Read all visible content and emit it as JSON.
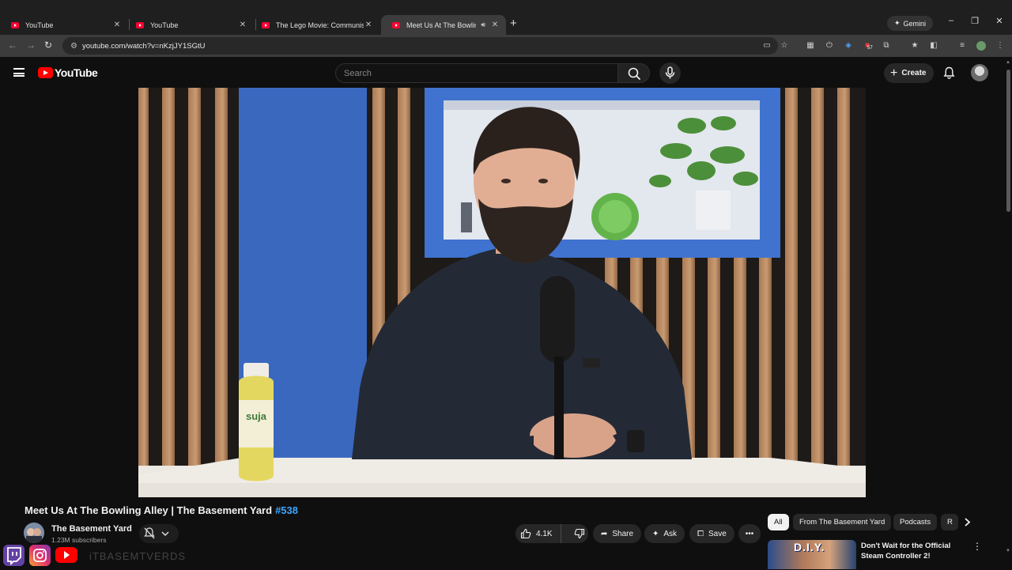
{
  "browser": {
    "tabs": [
      {
        "label": "YouTube",
        "active": false
      },
      {
        "label": "YouTube",
        "active": false
      },
      {
        "label": "The Lego Movie: Communist Pr",
        "active": false
      },
      {
        "label": "Meet Us At The Bowling All",
        "active": true
      }
    ],
    "gemini_label": "Gemini",
    "url": "youtube.com/watch?v=nKzjJY1SGtU",
    "extension_badge": "57"
  },
  "youtube": {
    "logo_text": "YouTube",
    "search_placeholder": "Search",
    "create_label": "Create"
  },
  "video": {
    "title": "Meet Us At The Bowling Alley | The Basement Yard",
    "episode_tag": "#538",
    "channel_name": "The Basement Yard",
    "subscribers": "1.23M subscribers",
    "likes": "4.1K",
    "share_label": "Share",
    "ask_label": "Ask",
    "save_label": "Save",
    "bottle_brand": "suja"
  },
  "chips": [
    {
      "label": "All",
      "active": true
    },
    {
      "label": "From The Basement Yard",
      "active": false
    },
    {
      "label": "Podcasts",
      "active": false
    },
    {
      "label": "R",
      "active": false
    }
  ],
  "recommendation": {
    "thumb_text": "D.I.Y.",
    "title": "Don't Wait for the Official Steam Controller 2!"
  },
  "overlay": {
    "handle_text": "iTBASEMTVERDS"
  },
  "colors": {
    "youtube_red": "#ff0000",
    "link_blue": "#3ea6ff",
    "background": "#0f0f0f"
  }
}
